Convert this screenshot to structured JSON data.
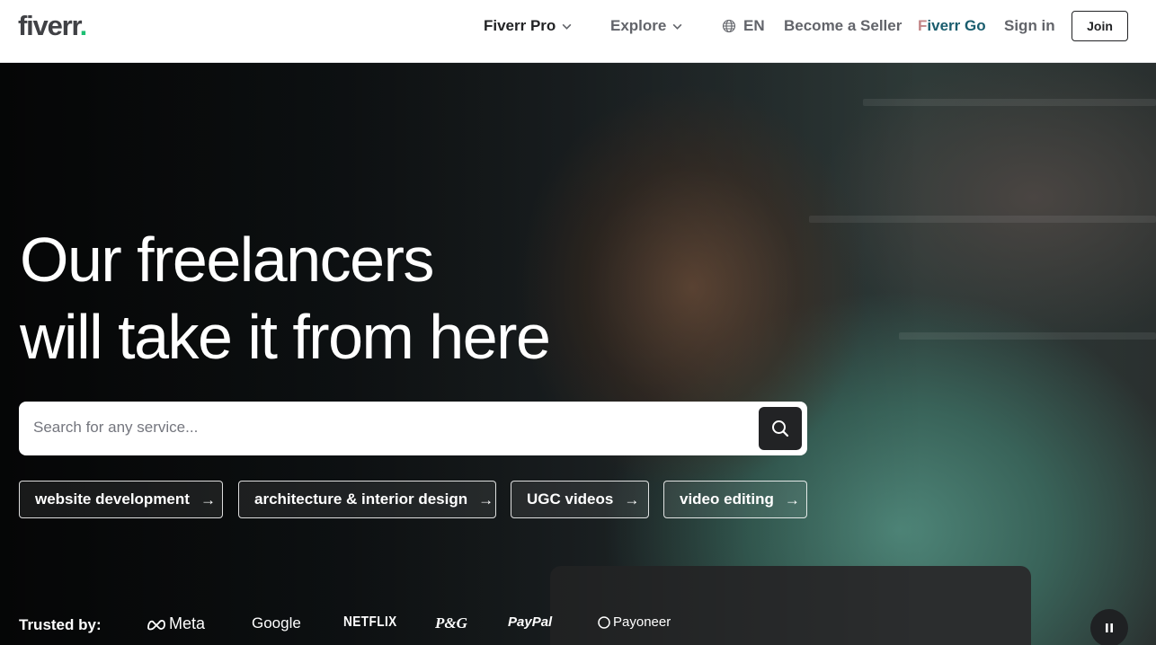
{
  "header": {
    "logo_text": "fiverr",
    "logo_dot": ".",
    "nav": {
      "fiverr_pro": "Fiverr Pro",
      "explore": "Explore",
      "language": "EN",
      "become_seller": "Become a Seller",
      "fiverr_go_first": "F",
      "fiverr_go_rest": "iverr Go",
      "sign_in": "Sign in",
      "join": "Join"
    }
  },
  "hero": {
    "headline_line1": "Our freelancers",
    "headline_line2": "will take it from here",
    "search": {
      "placeholder": "Search for any service..."
    },
    "chips": [
      {
        "label": "website development"
      },
      {
        "label": "architecture & interior design"
      },
      {
        "label": "UGC videos"
      },
      {
        "label": "video editing"
      }
    ],
    "chip_arrow": "→",
    "trusted_by": "Trusted by:",
    "brands": [
      "Meta",
      "Google",
      "NETFLIX",
      "P&G",
      "PayPal",
      "Payoneer"
    ]
  },
  "colors": {
    "brand_green": "#1dbf73",
    "text_dark": "#222325",
    "text_gray": "#62646a",
    "fiverr_go_teal": "#1a5d6e",
    "fiverr_go_pink": "#c28586"
  },
  "icons": [
    "chevron-down-icon",
    "globe-icon",
    "search-icon",
    "arrow-right-icon",
    "pause-icon",
    "meta-logo-icon",
    "payoneer-ring-icon"
  ]
}
